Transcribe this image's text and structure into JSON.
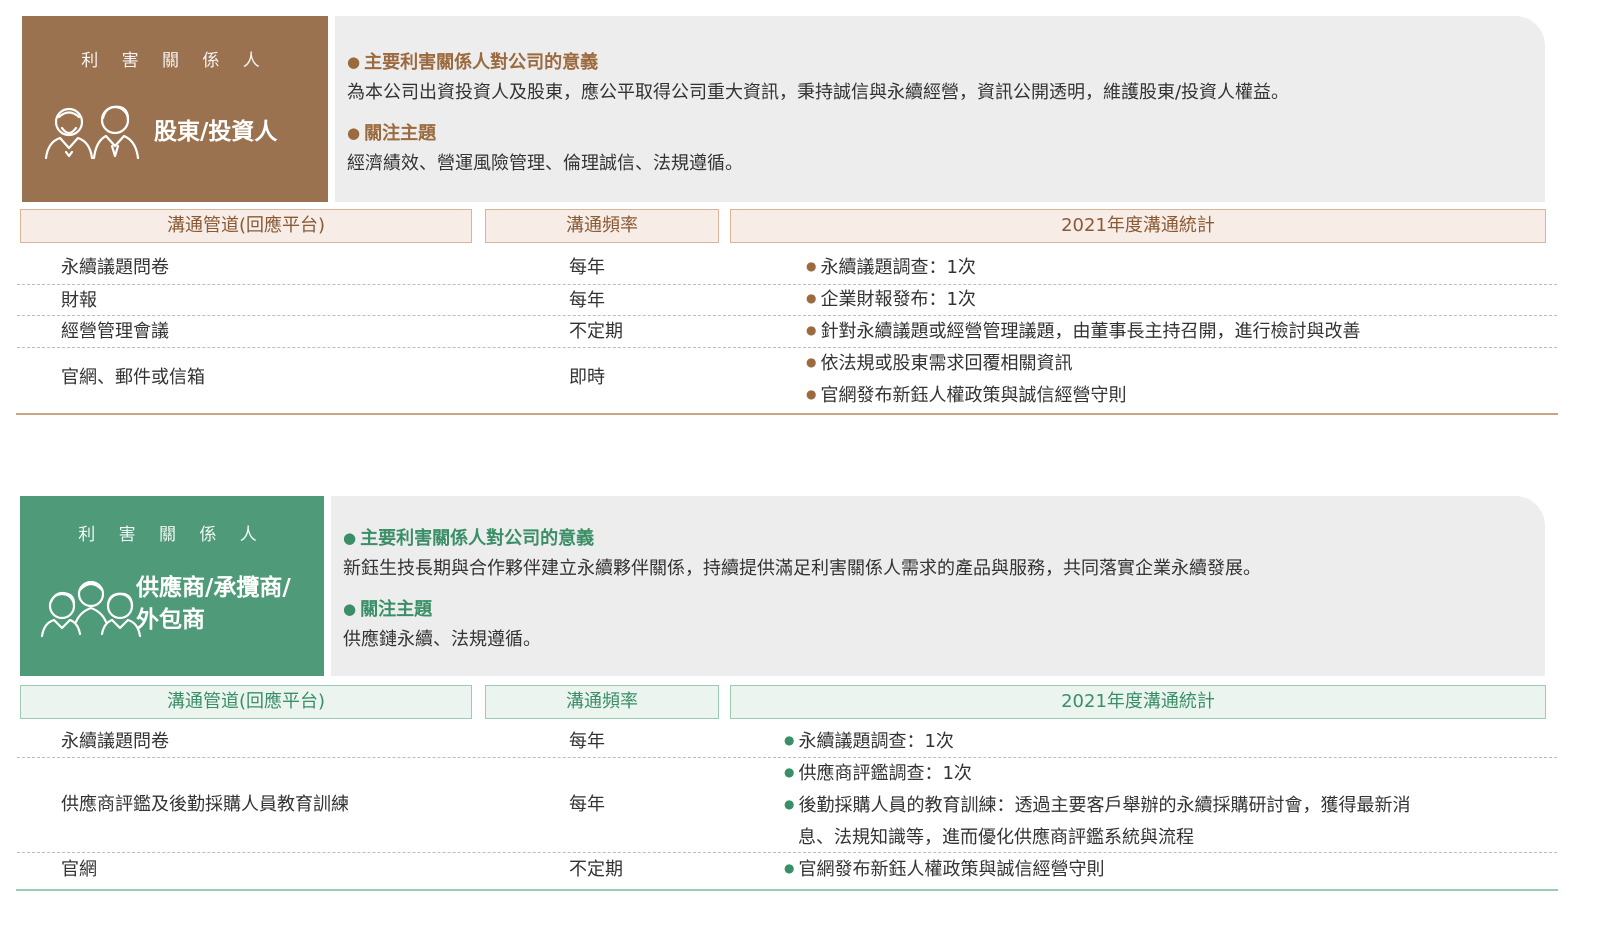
{
  "colors": {
    "brown": "#9b7250",
    "green": "#4f9a78",
    "panel_bg": "#ededed"
  },
  "common": {
    "header_tag": "利 害 關 係 人",
    "meaning_heading": "主要利害關係人對公司的意義",
    "topics_heading": "關注主題",
    "col_channel": "溝通管道(回應平台)",
    "col_frequency": "溝通頻率",
    "col_stats": "2021年度溝通統計"
  },
  "shareholders": {
    "icon": "investors-icon",
    "title": "股東/投資人",
    "meaning": "為本公司出資投資人及股東，應公平取得公司重大資訊，秉持誠信與永續經營，資訊公開透明，維護股東/投資人權益。",
    "topics": "經濟績效、營運風險管理、倫理誠信、法規遵循。",
    "rows": [
      {
        "channel": "永續議題問卷",
        "frequency": "每年",
        "stats": [
          "永續議題調查：1次"
        ]
      },
      {
        "channel": "財報",
        "frequency": "每年",
        "stats": [
          "企業財報發布：1次"
        ]
      },
      {
        "channel": "經營管理會議",
        "frequency": "不定期",
        "stats": [
          "針對永續議題或經營管理議題，由董事長主持召開，進行檢討與改善"
        ]
      },
      {
        "channel": "官網、郵件或信箱",
        "frequency": "即時",
        "stats": [
          "依法規或股東需求回覆相關資訊",
          "官網發布新鈺人權政策與誠信經營守則"
        ]
      }
    ]
  },
  "suppliers": {
    "icon": "suppliers-icon",
    "title_line1": "供應商/承攬商/",
    "title_line2": "外包商",
    "meaning": "新鈺生技長期與合作夥伴建立永續夥伴關係，持續提供滿足利害關係人需求的產品與服務，共同落實企業永續發展。",
    "topics": "供應鏈永續、法規遵循。",
    "rows": [
      {
        "channel": "永續議題問卷",
        "frequency": "每年",
        "stats": [
          "永續議題調查：1次"
        ]
      },
      {
        "channel": "供應商評鑑及後勤採購人員教育訓練",
        "frequency": "每年",
        "stats": [
          "供應商評鑑調查：1次",
          "後勤採購人員的教育訓練：透過主要客戶舉辦的永續採購研討會，獲得最新消",
          "息、法規知識等，進而優化供應商評鑑系統與流程"
        ]
      },
      {
        "channel": "官網",
        "frequency": "不定期",
        "stats": [
          "官網發布新鈺人權政策與誠信經營守則"
        ]
      }
    ]
  }
}
